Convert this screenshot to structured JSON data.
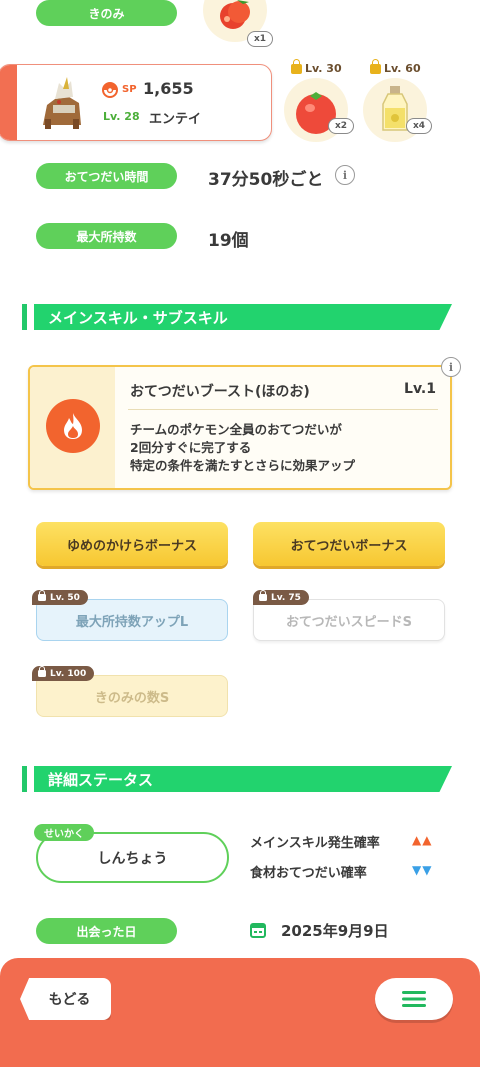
{
  "berry": {
    "label": "きのみ",
    "count": "x1"
  },
  "pokemon": {
    "sp_label": "SP",
    "sp_value": "1,655",
    "level": "Lv. 28",
    "name": "エンテイ"
  },
  "ingredients": [
    {
      "level": "Lv. 30",
      "count": "x2",
      "icon": "tomato-icon"
    },
    {
      "level": "Lv. 60",
      "count": "x4",
      "icon": "oil-bottle-icon"
    }
  ],
  "stats": {
    "help_time_label": "おてつだい時間",
    "help_time_value": "37分50秒ごと",
    "max_carry_label": "最大所持数",
    "max_carry_value": "19個"
  },
  "skills_section": {
    "title": "メインスキル・サブスキル",
    "main_skill": {
      "name": "おてつだいブースト(ほのお)",
      "level": "Lv.1",
      "desc_line1": "チームのポケモン全員のおてつだいが",
      "desc_line2": "2回分すぐに完了する",
      "desc_line3": "特定の条件を満たすとさらに効果アップ",
      "icon": "fire-icon"
    },
    "sub_skills": [
      {
        "name": "ゆめのかけらボーナス",
        "unlock": ""
      },
      {
        "name": "おてつだいボーナス",
        "unlock": ""
      },
      {
        "name": "最大所持数アップL",
        "unlock": "Lv. 50"
      },
      {
        "name": "おてつだいスピードS",
        "unlock": "Lv. 75"
      },
      {
        "name": "きのみの数S",
        "unlock": "Lv. 100"
      }
    ]
  },
  "details_section": {
    "title": "詳細ステータス",
    "nature_tag": "せいかく",
    "nature": "しんちょう",
    "up_label": "メインスキル発生確率",
    "up_arrows": "▲▲",
    "down_label": "食材おてつだい確率",
    "down_arrows": "▼▼",
    "met_label": "出会った日",
    "met_date": "2025年9月9日"
  },
  "nav": {
    "back": "もどる",
    "menu_icon": "hamburger-menu-icon"
  },
  "colors": {
    "green_pill": "#5fd05a",
    "section_green": "#22d36e",
    "accent_orange": "#f26c4f",
    "up_red": "#f2642e",
    "down_blue": "#3aa0e6"
  }
}
